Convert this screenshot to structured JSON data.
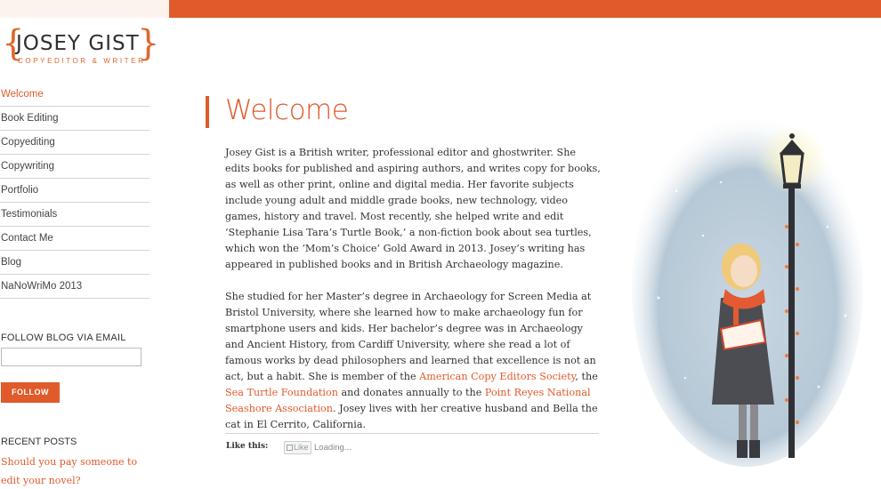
{
  "site": {
    "logo_name": "JOSEY GIST",
    "logo_tagline": "COPYEDITOR & WRITER"
  },
  "sidebar": {
    "nav": [
      {
        "label": "Welcome",
        "active": true
      },
      {
        "label": "Book Editing",
        "active": false
      },
      {
        "label": "Copyediting",
        "active": false
      },
      {
        "label": "Copywriting",
        "active": false
      },
      {
        "label": "Portfolio",
        "active": false
      },
      {
        "label": "Testimonials",
        "active": false
      },
      {
        "label": "Contact Me",
        "active": false
      },
      {
        "label": "Blog",
        "active": false
      },
      {
        "label": "NaNoWriMo 2013",
        "active": false
      }
    ],
    "follow_heading": "FOLLOW BLOG VIA EMAIL",
    "email_value": "",
    "follow_button": "FOLLOW",
    "recent_posts_heading": "RECENT POSTS",
    "recent_post_link": "Should you pay someone to edit your novel?"
  },
  "main": {
    "title": "Welcome",
    "paragraph1": "Josey Gist is a British writer, professional editor and ghostwriter. She edits books for published and aspiring authors, and writes copy for books, as well as other print, online and digital media. Her favorite subjects include young adult and middle grade books, new technology, video games, history and travel. Most recently, she helped write and edit ‘Stephanie Lisa Tara’s Turtle Book,’ a non-fiction book about sea turtles, which won the ‘Mom’s Choice’ Gold Award in 2013. Josey’s writing has appeared in published books and in British Archaeology magazine.",
    "paragraph2": {
      "part1": "She studied for her Master’s degree in Archaeology for Screen Media at Bristol University, where she learned how to make archaeology fun for smartphone users and kids. Her bachelor’s degree was in Archaeology and Ancient History, from Cardiff University, where she read a lot of famous works by dead philosophers and learned that excellence is not an act, but a habit. She is member of the ",
      "link1": "American Copy Editors Society",
      "part2": ", the ",
      "link2": "Sea Turtle Foundation",
      "part3": " and donates annually to the ",
      "link3": "Point Reyes National Seashore Association",
      "part4": ". Josey lives with her creative husband and Bella the cat in El Cerrito, California."
    },
    "like_label": "Like this:",
    "like_button": "Like",
    "loading_text": "Loading..."
  },
  "colors": {
    "accent": "#e05a2b",
    "topbar_left": "#fcf3ee"
  }
}
